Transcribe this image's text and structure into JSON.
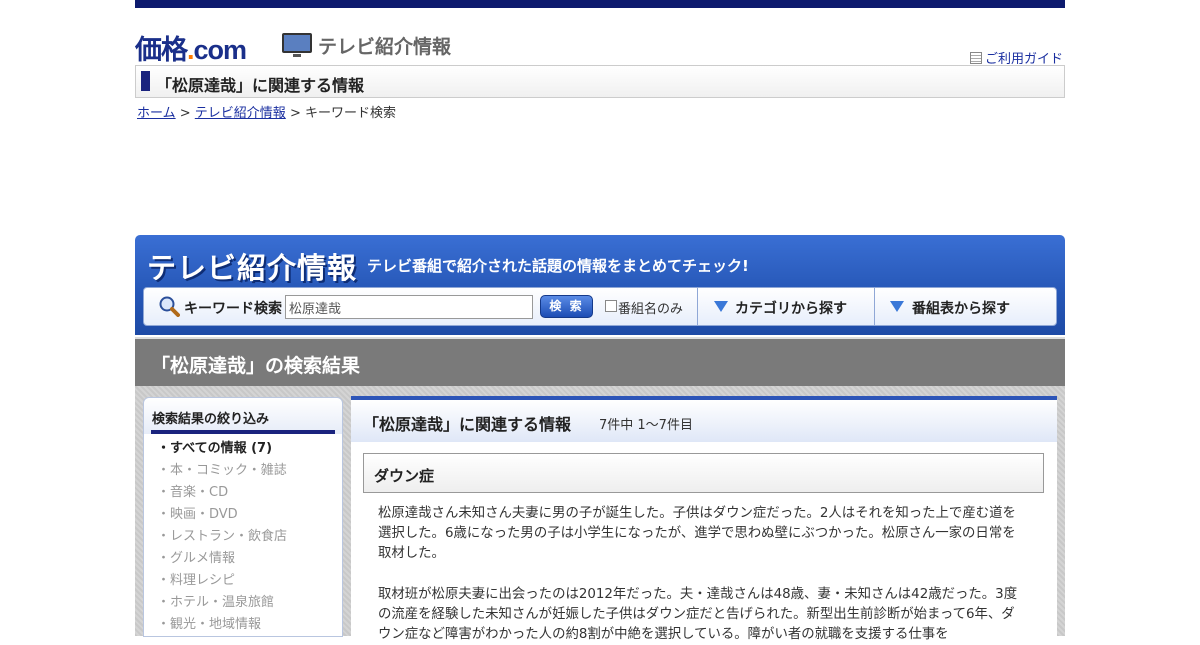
{
  "header": {
    "logo_main": "価格",
    "logo_dot": ".",
    "logo_com": "com",
    "section_title": "テレビ紹介情報",
    "guide_label": "ご利用ガイド"
  },
  "title_bar": {
    "text": "「松原達哉」に関連する情報"
  },
  "breadcrumb": {
    "home": "ホーム",
    "sep1": " > ",
    "tv": "テレビ紹介情報",
    "sep2": " > ",
    "current": "キーワード検索"
  },
  "banner": {
    "logo_text": "テレビ紹介情報",
    "tagline": "テレビ番組で紹介された話題の情報をまとめてチェック!",
    "keyword_label": "キーワード検索",
    "keyword_value": "松原達哉",
    "search_button": "検 索",
    "program_only_label": "番組名のみ",
    "category_button": "カテゴリから探す",
    "schedule_button": "番組表から探す"
  },
  "results_heading": "「松原達哉」の検索結果",
  "sidebar": {
    "title": "検索結果の絞り込み",
    "items": [
      {
        "label": "・すべての情報 (7)",
        "active": true
      },
      {
        "label": "・本・コミック・雑誌",
        "active": false
      },
      {
        "label": "・音楽・CD",
        "active": false
      },
      {
        "label": "・映画・DVD",
        "active": false
      },
      {
        "label": "・レストラン・飲食店",
        "active": false
      },
      {
        "label": "・グルメ情報",
        "active": false
      },
      {
        "label": "・料理レシピ",
        "active": false
      },
      {
        "label": "・ホテル・温泉旅館",
        "active": false
      },
      {
        "label": "・観光・地域情報",
        "active": false
      }
    ]
  },
  "main": {
    "title": "「松原達哉」に関連する情報",
    "count": "7件中 1～7件目",
    "topic_title": "ダウン症",
    "paragraph1": "松原達哉さん未知さん夫妻に男の子が誕生した。子供はダウン症だった。2人はそれを知った上で産む道を選択した。6歳になった男の子は小学生になったが、進学で思わぬ壁にぶつかった。松原さん一家の日常を取材した。",
    "paragraph2": "取材班が松原夫妻に出会ったのは2012年だった。夫・達哉さんは48歳、妻・未知さんは42歳だった。3度の流産を経験した未知さんが妊娠した子供はダウン症だと告げられた。新型出生前診断が始まって6年、ダウン症など障害がわかった人の約8割が中絶を選択している。障がい者の就職を支援する仕事を"
  },
  "colors": {
    "navy": "#0d1a6e",
    "banner_blue": "#2758b8",
    "link": "#1a2fa0",
    "accent_orange": "#ff7a00"
  }
}
